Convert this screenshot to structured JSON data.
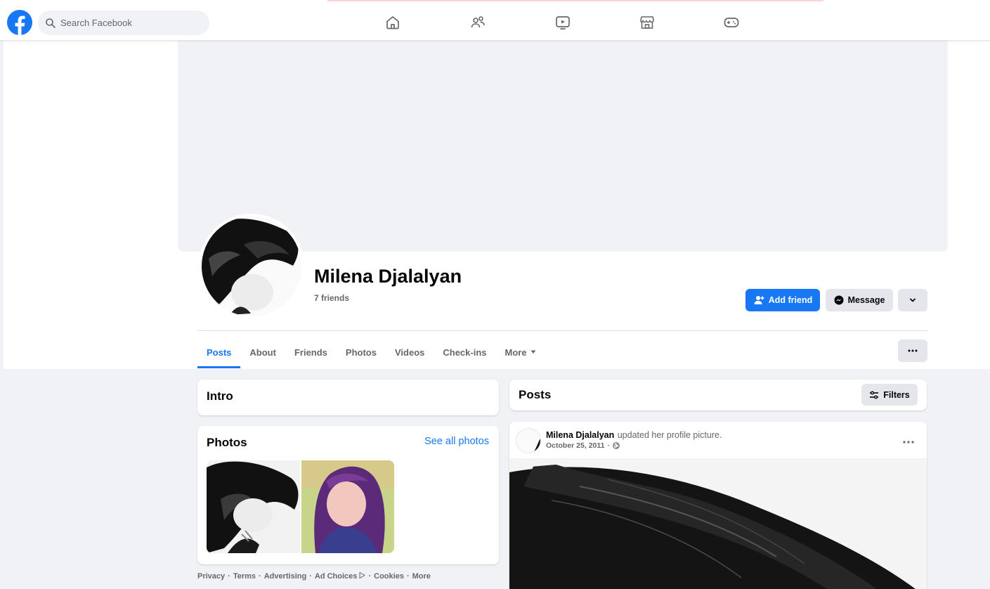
{
  "search": {
    "placeholder": "Search Facebook"
  },
  "nav": {
    "items": [
      {
        "name": "home-icon"
      },
      {
        "name": "friends-icon"
      },
      {
        "name": "watch-icon"
      },
      {
        "name": "marketplace-icon"
      },
      {
        "name": "gaming-icon"
      }
    ]
  },
  "profile": {
    "name": "Milena Djalalyan",
    "friends": "7 friends"
  },
  "actions": {
    "add_friend": "Add friend",
    "message": "Message"
  },
  "tabs": [
    {
      "label": "Posts",
      "active": true
    },
    {
      "label": "About"
    },
    {
      "label": "Friends"
    },
    {
      "label": "Photos"
    },
    {
      "label": "Videos"
    },
    {
      "label": "Check-ins"
    },
    {
      "label": "More"
    }
  ],
  "intro": {
    "title": "Intro"
  },
  "photos": {
    "title": "Photos",
    "see_all": "See all photos"
  },
  "footer": {
    "links": [
      "Privacy",
      "Terms",
      "Advertising",
      "Ad Choices",
      "Cookies",
      "More"
    ],
    "separator": "·"
  },
  "posts_header": {
    "title": "Posts",
    "filters": "Filters"
  },
  "post": {
    "author": "Milena Djalalyan",
    "action": "updated her profile picture.",
    "date": "October 25, 2011",
    "date_separator": "·"
  },
  "colors": {
    "brand": "#1877f2",
    "background": "#f0f2f5",
    "secondary_text": "#65676b"
  }
}
